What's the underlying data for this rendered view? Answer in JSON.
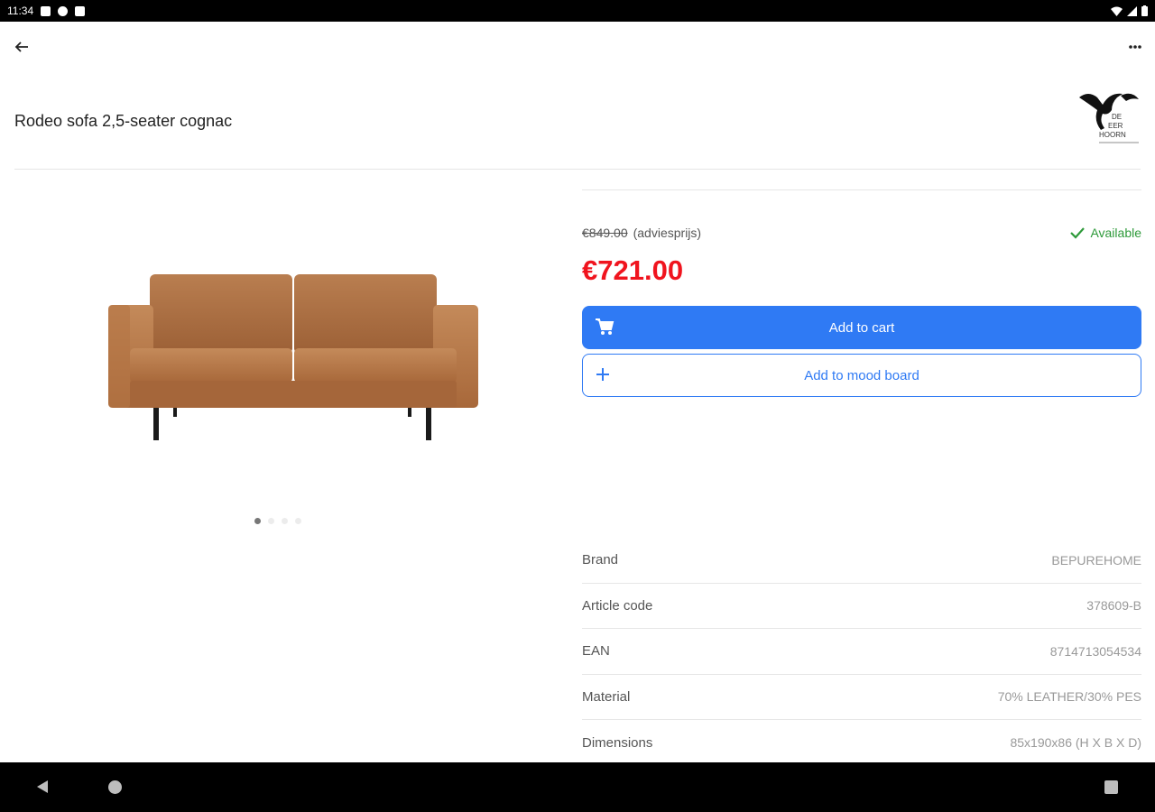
{
  "status_bar": {
    "time": "11:34"
  },
  "product": {
    "title": "Rodeo sofa 2,5-seater cognac",
    "old_price": "€849.00",
    "old_price_note": "(adviesprijs)",
    "sale_price": "€721.00",
    "availability": "Available"
  },
  "buttons": {
    "add_to_cart": "Add to cart",
    "add_to_mood_board": "Add to mood board"
  },
  "gallery": {
    "image_count": 4,
    "active_index": 0
  },
  "specs": [
    {
      "label": "Brand",
      "value": "BEPUREHOME"
    },
    {
      "label": "Article code",
      "value": "378609-B"
    },
    {
      "label": "EAN",
      "value": "8714713054534"
    },
    {
      "label": "Material",
      "value": "70% LEATHER/30% PES"
    },
    {
      "label": "Dimensions",
      "value": "85x190x86 (H X B X D)"
    }
  ],
  "colors": {
    "accent": "#2f7af4",
    "sale_price": "#f0141e",
    "available": "#2e9a3a"
  },
  "icons": {
    "back": "arrow-left-icon",
    "more": "more-horizontal-icon",
    "cart": "cart-icon",
    "add": "plus-icon",
    "available": "check-icon"
  }
}
